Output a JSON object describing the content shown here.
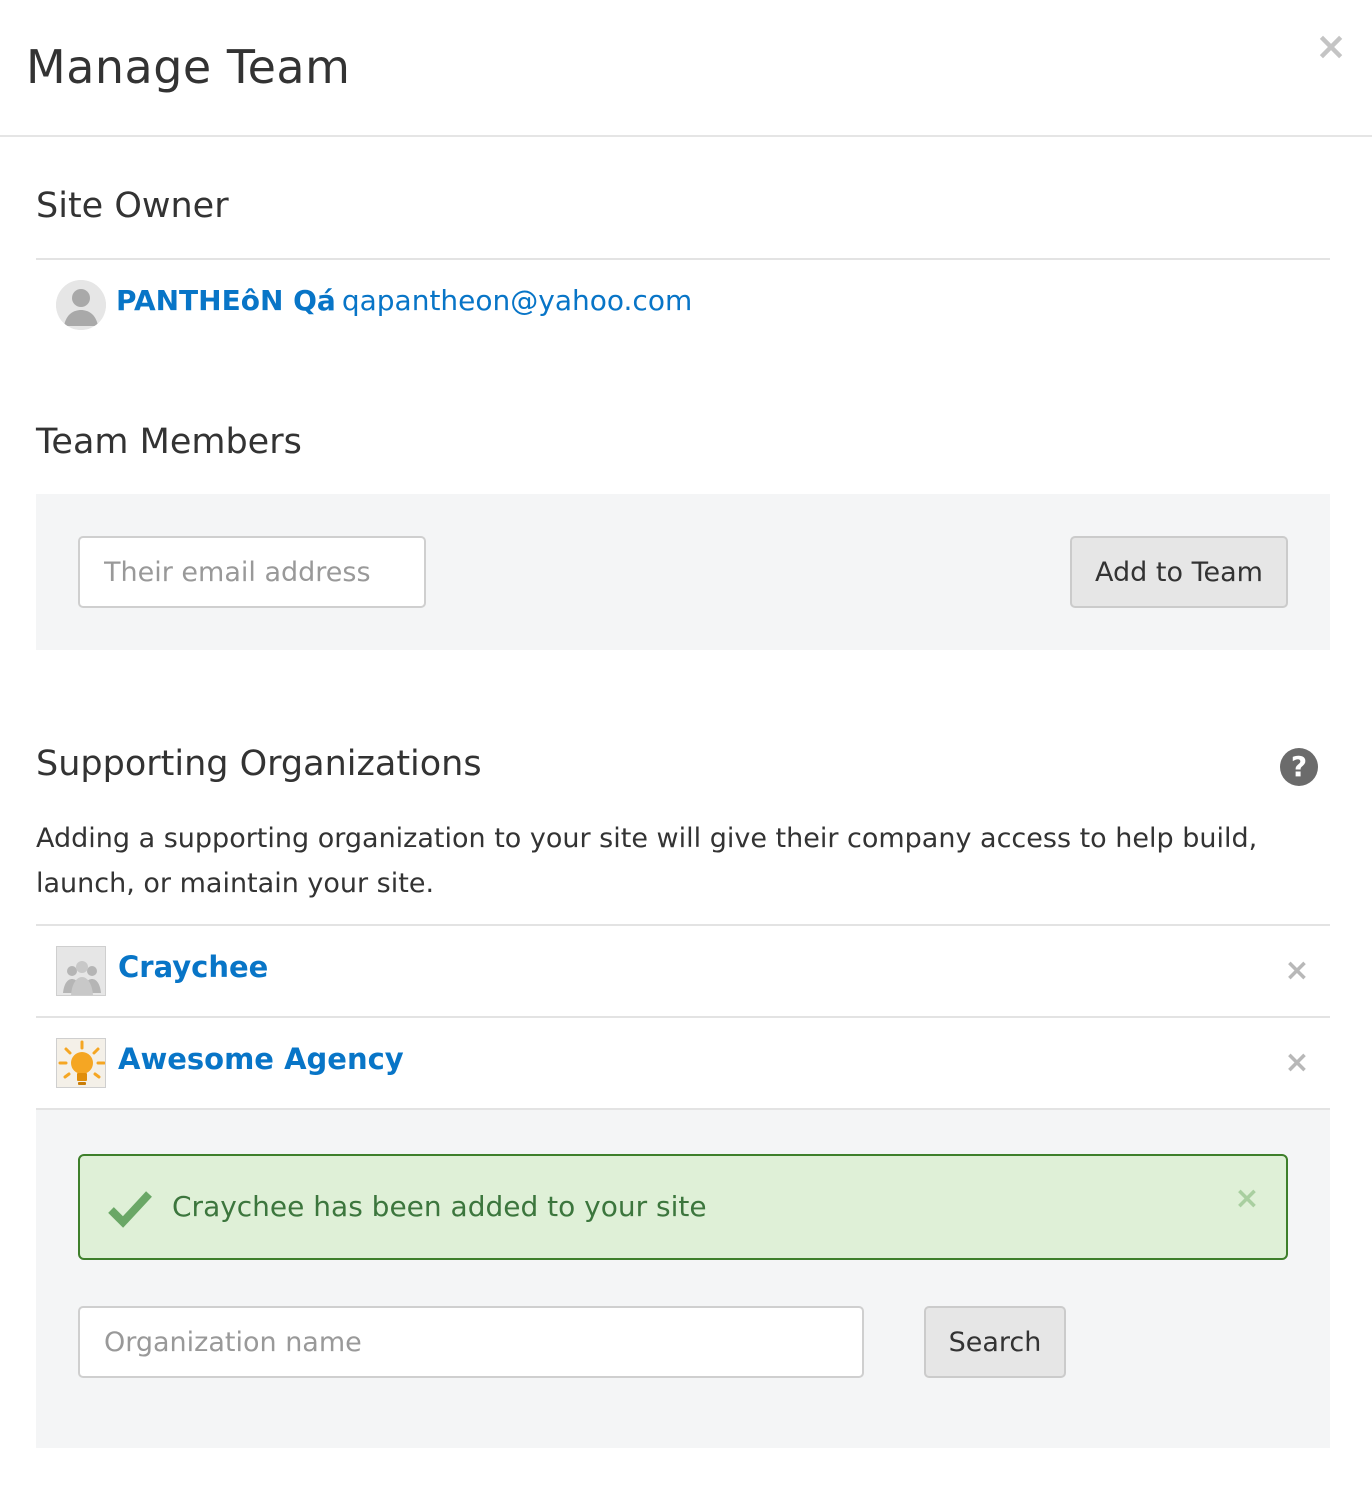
{
  "header": {
    "title": "Manage Team",
    "close_label": "×"
  },
  "owner_section": {
    "title": "Site Owner",
    "owner_name": "PANTHEôN Qá",
    "owner_email": "qapantheon@yahoo.com"
  },
  "team_section": {
    "title": "Team Members",
    "email_placeholder": "Their email address",
    "email_value": "",
    "add_button_label": "Add to Team"
  },
  "orgs_section": {
    "title": "Supporting Organizations",
    "help_label": "?",
    "description": "Adding a supporting organization to your site will give their company access to help build, launch, or maintain your site.",
    "organizations": [
      {
        "name": "Craychee",
        "logo_icon": "group-placeholder-icon",
        "remove_label": "×"
      },
      {
        "name": "Awesome Agency",
        "logo_icon": "lightbulb-icon",
        "remove_label": "×"
      }
    ],
    "alert": {
      "text": "Craychee has been added to your site",
      "icon": "checkmark-icon",
      "close_label": "×",
      "bg_color": "#dff0d7",
      "border_color": "#3e7f2b",
      "text_color": "#3c763d"
    },
    "search_placeholder": "Organization name",
    "search_value": "",
    "search_button_label": "Search"
  },
  "colors": {
    "link": "#0875c7",
    "panel_bg": "#f4f5f6",
    "text": "#333333"
  }
}
